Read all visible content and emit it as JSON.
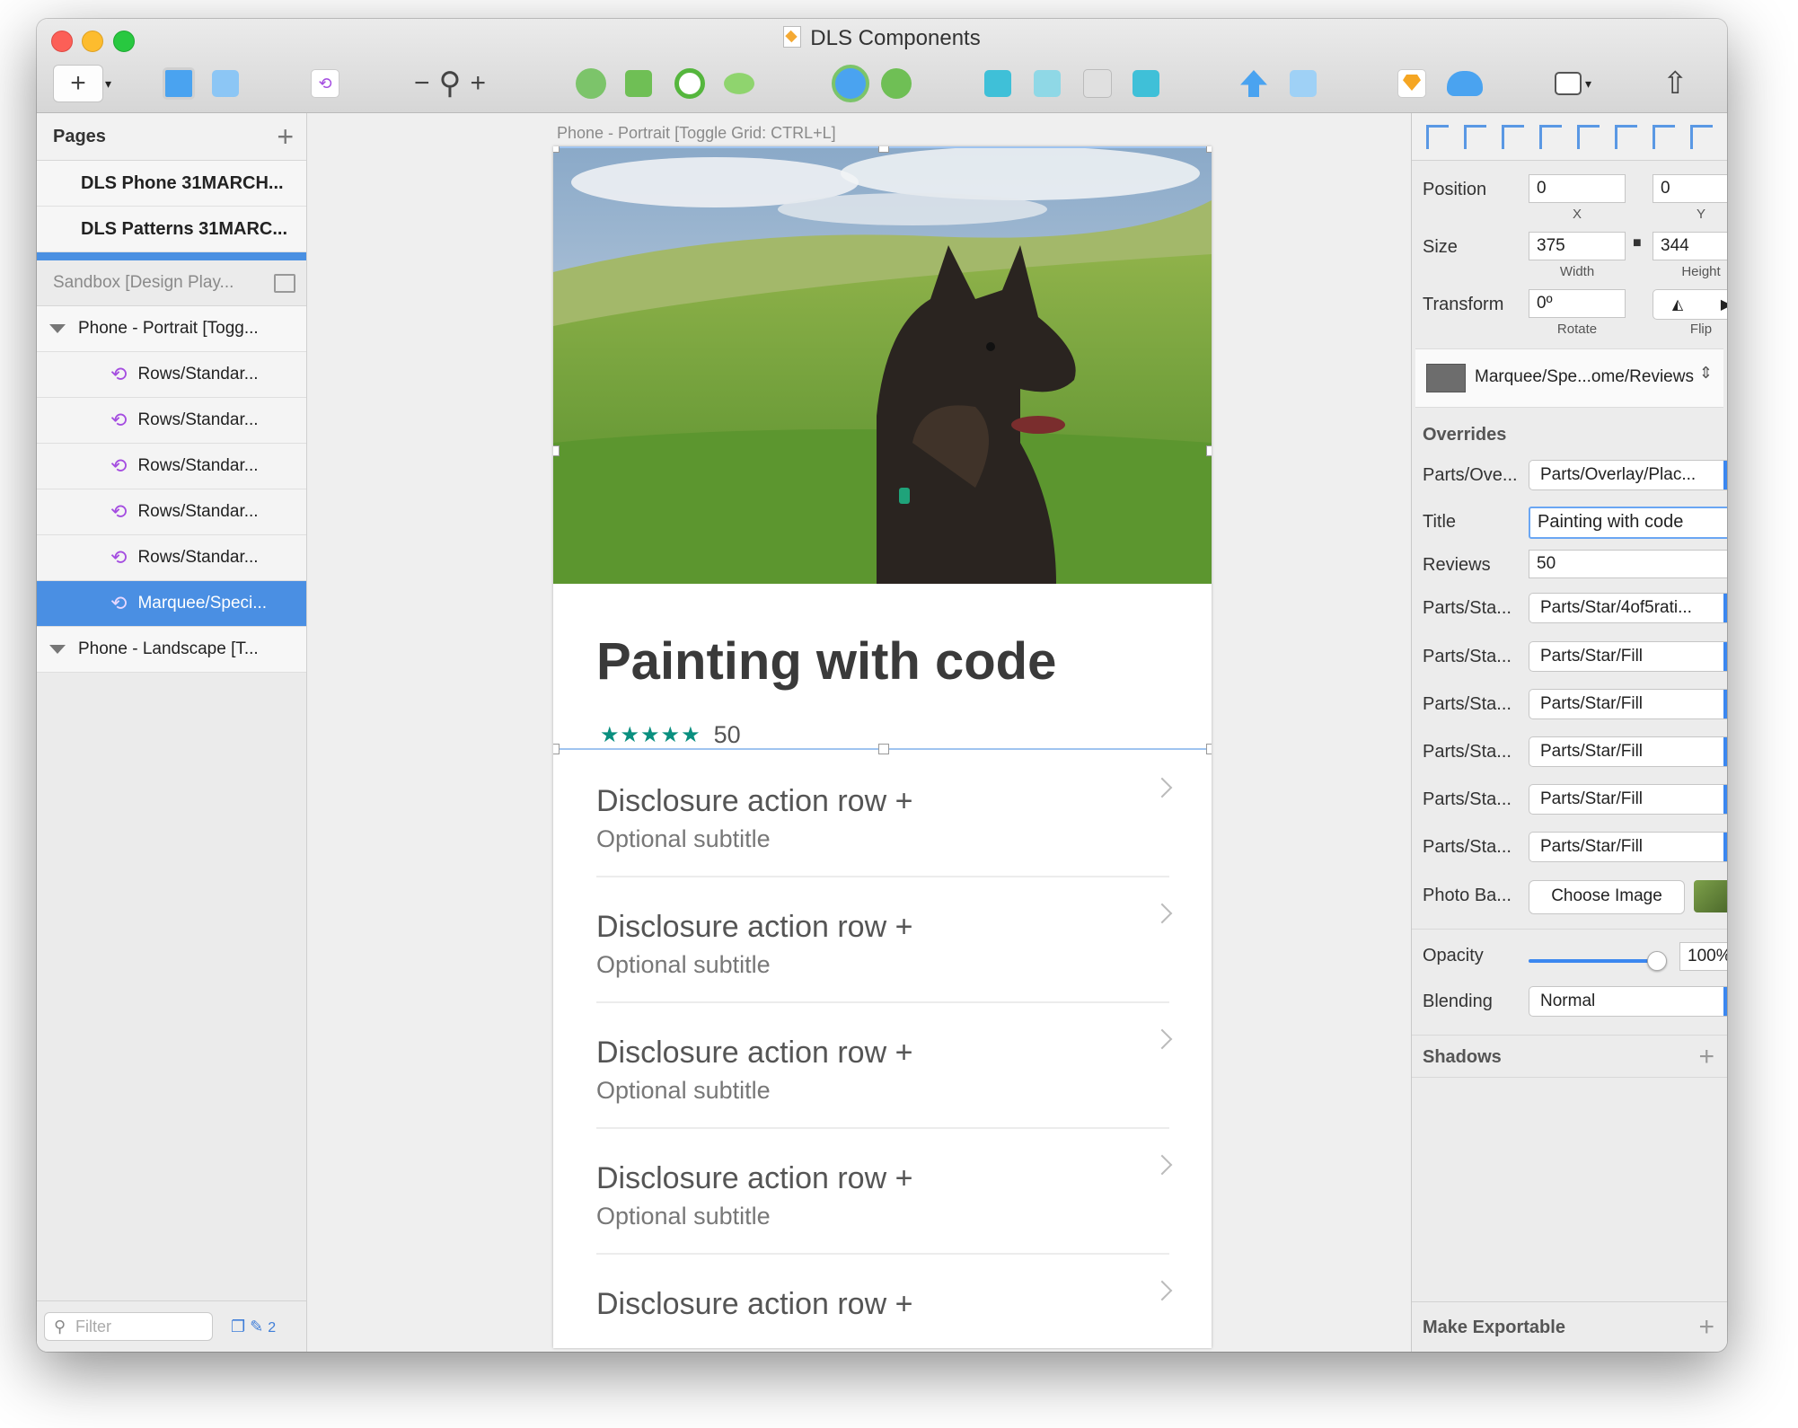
{
  "window": {
    "title": "DLS Components"
  },
  "pages": {
    "header": "Pages",
    "items": [
      "DLS Phone 31MARCH...",
      "DLS Patterns 31MARC..."
    ]
  },
  "layers": {
    "sandbox": "Sandbox [Design Play...",
    "portrait_group": "Phone - Portrait [Togg...",
    "children": [
      "Rows/Standar...",
      "Rows/Standar...",
      "Rows/Standar...",
      "Rows/Standar...",
      "Rows/Standar...",
      "Marquee/Speci..."
    ],
    "landscape_group": "Phone - Landscape [T..."
  },
  "footer": {
    "filter_placeholder": "Filter",
    "count": "2"
  },
  "canvas": {
    "artboard_label": "Phone - Portrait [Toggle Grid: CTRL+L]",
    "title": "Painting with code",
    "stars": "★★★★★",
    "reviews": "50",
    "rows": [
      {
        "title": "Disclosure action row +",
        "subtitle": "Optional subtitle"
      },
      {
        "title": "Disclosure action row +",
        "subtitle": "Optional subtitle"
      },
      {
        "title": "Disclosure action row +",
        "subtitle": "Optional subtitle"
      },
      {
        "title": "Disclosure action row +",
        "subtitle": "Optional subtitle"
      },
      {
        "title": "Disclosure action row +",
        "subtitle": ""
      }
    ]
  },
  "inspector": {
    "position_label": "Position",
    "x_value": "0",
    "x_caption": "X",
    "y_value": "0",
    "y_caption": "Y",
    "size_label": "Size",
    "width_value": "375",
    "width_caption": "Width",
    "height_value": "344",
    "height_caption": "Height",
    "transform_label": "Transform",
    "rotate_value": "0º",
    "rotate_caption": "Rotate",
    "flip_caption": "Flip",
    "symbol_name": "Marquee/Spe...ome/Reviews",
    "overrides_header": "Overrides",
    "overrides": [
      {
        "label": "Parts/Ove...",
        "value": "Parts/Overlay/Plac..."
      },
      {
        "label": "Parts/Sta...",
        "value": "Parts/Star/4of5rati..."
      },
      {
        "label": "Parts/Sta...",
        "value": "Parts/Star/Fill"
      },
      {
        "label": "Parts/Sta...",
        "value": "Parts/Star/Fill"
      },
      {
        "label": "Parts/Sta...",
        "value": "Parts/Star/Fill"
      },
      {
        "label": "Parts/Sta...",
        "value": "Parts/Star/Fill"
      },
      {
        "label": "Parts/Sta...",
        "value": "Parts/Star/Fill"
      }
    ],
    "title_label": "Title",
    "title_value": "Painting with code",
    "reviews_label": "Reviews",
    "reviews_value": "50",
    "photo_label": "Photo Ba...",
    "choose_image": "Choose Image",
    "opacity_label": "Opacity",
    "opacity_value": "100%",
    "opacity_level": 1.0,
    "blending_label": "Blending",
    "blending_value": "Normal",
    "shadows_header": "Shadows",
    "exportable_header": "Make Exportable"
  },
  "colors": {
    "accent": "#3b87f0",
    "selection": "#4a8fe3",
    "star": "#0a8f7f",
    "symbol": "#a44ce0"
  }
}
